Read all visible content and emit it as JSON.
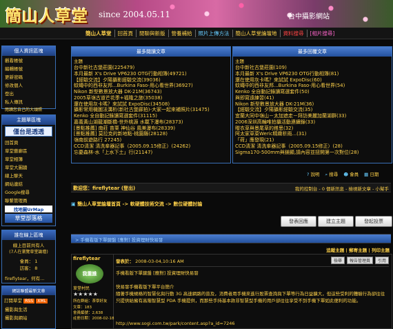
{
  "header": {
    "logo": "簡山人草堂",
    "since": "since 2004.05.11",
    "tag": "台中攝影網站"
  },
  "nav": [
    "簡山人草堂",
    "回首頁",
    "閒聊與新版",
    "營養補給",
    "照片上傳方法",
    "簡山人草堂論壇地",
    "資料搜尋",
    "[相片搜尋]"
  ],
  "sidebar": {
    "personal": {
      "title": "個人資訊區塊",
      "links": [
        "觀看帳號",
        "編輯帳號",
        "更新密碼",
        "修改個人",
        "登出",
        "私人傳訊",
        "閱讀您自己的大頭照"
      ]
    },
    "forum": {
      "title": "主題單區塊",
      "banner": "僅台是透透",
      "links": [
        "回首頁",
        "草堂藝廊區",
        "草堂相簿",
        "草堂大圖牆",
        "線上聊天",
        "網站連結",
        "Google搜尋",
        "聯繫管理員"
      ],
      "map_label": "找地圖UrMap",
      "badge": "草堂部落格"
    },
    "online": {
      "title": "誰在線上區塊",
      "text": "線上目前共有人",
      "detail": "(7人在瀏覽草堂論壇)",
      "members_label": "會員：",
      "members": "1",
      "guests_label": "訪客：",
      "guests": "8",
      "user": "fireflytear，何有..."
    },
    "news": {
      "title": "網誌聯盟最新文章",
      "rss": "RSS",
      "xml": "XML",
      "links": [
        "訂閱草堂",
        "攝影與生活",
        "攝影與網站"
      ]
    }
  },
  "panels": {
    "left": {
      "title": "最多閱讀文章",
      "head": "主題",
      "items": [
        "台中新社古堡莊園(225479)",
        "本月最新 X's Drive VP6230 OTG行動相簿(49721)",
        "【經驗交流】夕陽攝影經驗交流(39036)",
        "蚊蠅中的西非友邦...Burkina Faso-用心看世界(36927)",
        "Nikon 新型數景放大器 DK-21M(36743)",
        "2005草嶺古道芒花季+福隆之旅(35038)",
        "還在使用灰卡嗎？來試試 ExpoDisc(34508)",
        "攝影常用機圖法溝析(新社古堡廊拍)-大家一起來補照片(31475)",
        "Kenko 全自動記錄讀寫選套件(31115)",
        "嘉義黃山湖龍潮斷橋-世外桃源 水載下瀑布(28373)",
        "[景點推薦] 南莊 苗栗 神仙谷 風美瀑布(28339)",
        "[景點推薦] 莫拉克的新地點-桃園縣(28128)",
        "嶺南前遊路行 27245)",
        "CCD清潔 清洗傘器記事（2005.09.15修正）(24262)",
        "忘憂森林-水「上水下土」行(21147)"
      ]
    },
    "right": {
      "title": "最多回覆文章",
      "head": "主題",
      "items": [
        "台中新社古堡莊園(109)",
        "本月最新 X's Drive VP6230 OTG行動相簿(81)",
        "還在使用灰卡嗎？來試試 ExpoDisc(60)",
        "蚊蠅中的西非友邦...Burkina Faso-用心看世界(54)",
        "Kenko 全自動記錄讀寫選套件(50)",
        "與即寫遠練習(41)",
        "Nikon 新型數景放大器 DK-21M(36)",
        "【經驗交流】夕陽攝影經驗交流(35)",
        "宜蘭大同中嶺山－太加遮走－拜訪美麗加蘭湖群(33)",
        "2006深圳高輪唯拍攝活動連續錄(33)",
        "贈衣草與景尾草的搭思(32)",
        "阿太家草菜Weric精緻析雨...(31)",
        "「荷」應發現(21)",
        "CCD清潔 清洗傘器記事（2005.09.15修正）(28)",
        "Sigma170-500mm與鎂顯,請內容並扭開第一次對位(28)"
      ]
    }
  },
  "action_icons": [
    "說明",
    "搜尋",
    "會員",
    "日期"
  ],
  "welcome": {
    "text": "歡迎您：fireflytear (登出)",
    "right": "我的控制台 - 0 個新訊息 - 檢視新文章 - 小幫手"
  },
  "breadcrumb": "簡山人草堂論壇首頁 -> 軟硬體技術交流 -> 數位硬體討論",
  "buttons": {
    "reply": "發表回應",
    "new_topic": "建立主題",
    "new_poll": "發起投票"
  },
  "thread": {
    "options": "追蹤主題 | 郵寄主題 | 列印主題",
    "topic_label": "> 手機看版下單鍵盤 [應對] 投資理財快易發"
  },
  "post": {
    "author": "fireflytear",
    "avatar_text": "我重誰",
    "rank": "草堂村民",
    "stars": "★★★★★",
    "stats": [
      {
        "label": "所在群組：",
        "value": "茶學好友"
      },
      {
        "label": "文章：",
        "value": "183"
      },
      {
        "label": "會員編號：",
        "value": "2,638"
      },
      {
        "label": "註冊日期：",
        "value": "2008-02-18"
      }
    ],
    "date_label": "發表於：",
    "date": "2008-03-04,10:16 AM",
    "buttons": [
      "檢舉",
      "報告管理員",
      "引用"
    ],
    "title": "手機看版下單鍵盤 [應對] 投資理財快易發",
    "subtitle": "快易發手機看版下單平台簡介",
    "body": "隨著手機規格的智慧化與行動 3G 高速網路的普及，消費者用手機來進行股票查詢與下單等行為日益擴大，但這些受利的體驗行為卻往往只提供給擁有高階智慧型 PDA 手機提供，而那些手持基本款非智慧型手機的用戶卻往往享受不到手機下單如此便利的功能。",
    "link": "http://www.sogi.com.tw/park/content.asp?a_id=7246"
  }
}
